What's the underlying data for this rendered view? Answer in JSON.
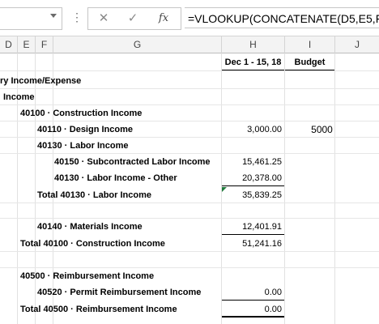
{
  "formula_bar": {
    "namebox_value": "",
    "menu_icon": "vertical-ellipsis-icon",
    "cancel_icon": "close-icon",
    "enter_icon": "check-icon",
    "fx_label": "fx",
    "formula": "=VLOOKUP(CONCATENATE(D5,E5,F5,"
  },
  "columns": [
    "D",
    "E",
    "F",
    "G",
    "H",
    "I",
    "J"
  ],
  "header_row": {
    "h": "Dec 1 - 15, 18",
    "i": "Budget"
  },
  "rows": [
    {
      "text": "ry Income/Expense"
    },
    {
      "text": "Income"
    },
    {
      "text": "40100 · Construction Income"
    },
    {
      "text": "40110 · Design Income",
      "amount": "3,000.00",
      "budget": "5000"
    },
    {
      "text": "40130 · Labor Income"
    },
    {
      "text": "40150 · Subcontracted Labor Income",
      "amount": "15,461.25"
    },
    {
      "text": "40130 · Labor Income - Other",
      "amount": "20,378.00"
    },
    {
      "text": "Total 40130 · Labor Income",
      "amount": "35,839.25"
    },
    {
      "text": ""
    },
    {
      "text": "40140 · Materials Income",
      "amount": "12,401.91"
    },
    {
      "text": "Total 40100 · Construction Income",
      "amount": "51,241.16"
    },
    {
      "text": ""
    },
    {
      "text": "40500 · Reimbursement Income"
    },
    {
      "text": "40520 · Permit Reimbursement Income",
      "amount": "0.00"
    },
    {
      "text": "Total 40500 · Reimbursement Income",
      "amount": "0.00"
    }
  ],
  "colors": {
    "grid": "#e1e1e1",
    "header_bg": "#f3f3f3",
    "error_marker": "#1f7a3b"
  }
}
